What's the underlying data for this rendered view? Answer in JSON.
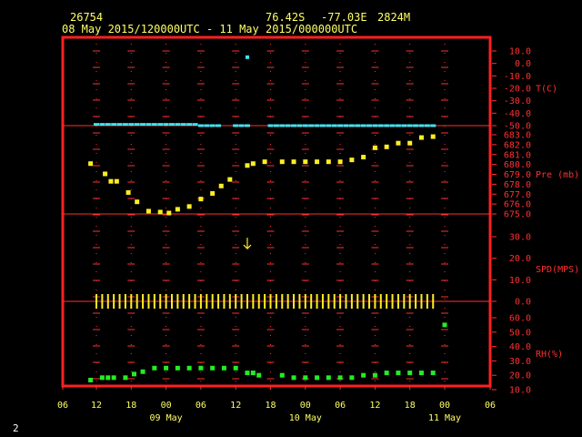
{
  "header": {
    "station_id": "26754",
    "latitude": "76.42S",
    "longitude": "-77.03E",
    "elevation": "2824M",
    "period": "08 May 2015/120000UTC - 11 May 2015/000000UTC"
  },
  "page_number": "2",
  "colors": {
    "frame": "#ff2020",
    "grid": "#ff3030",
    "axis_text_right": "#ff3030",
    "axis_text_bottom": "#ffff66",
    "temperature": "#44e0ee",
    "pressure": "#ffee22",
    "wind": "#ffee22",
    "humidity": "#22ee22"
  },
  "chart_data": {
    "type": "scatter",
    "x_axis": {
      "tick_labels": [
        "06",
        "12",
        "18",
        "00",
        "06",
        "12",
        "18",
        "00",
        "06",
        "12",
        "18",
        "00",
        "06"
      ],
      "tick_hours": [
        -6,
        0,
        6,
        12,
        18,
        24,
        30,
        36,
        42,
        48,
        54,
        60,
        66
      ],
      "date_labels": [
        {
          "label": "09 May",
          "hour": 12
        },
        {
          "label": "10 May",
          "hour": 36
        },
        {
          "label": "11 May",
          "hour": 60
        }
      ],
      "xlim_hours": [
        -6,
        66
      ]
    },
    "panels": [
      {
        "name": "temperature",
        "ylabel": "T(C)",
        "tick_labels": [
          "10.0",
          "0.0",
          "-10.0",
          "-20.0",
          "-30.0",
          "-40.0",
          "-50.0"
        ],
        "ylim": [
          -50,
          10
        ],
        "series": [
          {
            "style": "dash",
            "x": [
              0,
              1,
              2,
              3,
              4,
              5,
              6,
              7,
              8,
              9,
              10,
              11,
              12,
              13,
              14,
              15,
              16,
              17,
              18,
              19,
              20,
              21,
              24,
              25,
              26,
              30,
              31,
              32,
              33,
              34,
              35,
              36,
              37,
              38,
              39,
              40,
              41,
              42,
              43,
              44,
              45,
              46,
              47,
              48,
              49,
              50,
              51,
              52,
              53,
              54,
              55,
              56,
              57,
              58
            ],
            "y": [
              -49,
              -49,
              -49,
              -49,
              -49,
              -49,
              -49,
              -49,
              -49,
              -49,
              -49,
              -49,
              -49,
              -49,
              -49,
              -49,
              -49,
              -49,
              -50,
              -50,
              -50,
              -50,
              -50,
              -50,
              -50,
              -50,
              -50,
              -50,
              -50,
              -50,
              -50,
              -50,
              -50,
              -50,
              -50,
              -50,
              -50,
              -50,
              -50,
              -50,
              -50,
              -50,
              -50,
              -50,
              -50,
              -50,
              -50,
              -50,
              -50,
              -50,
              -50,
              -50,
              -50,
              -50
            ]
          },
          {
            "style": "square",
            "x": [
              26
            ],
            "y": 5
          }
        ]
      },
      {
        "name": "pressure",
        "ylabel": "Pre (mb)",
        "tick_labels": [
          "683.0",
          "682.0",
          "681.0",
          "680.0",
          "679.0",
          "678.0",
          "677.0",
          "676.0",
          "675.0"
        ],
        "ylim": [
          675,
          683.5
        ],
        "series": [
          {
            "style": "square",
            "x": [
              -1,
              1.5,
              2.5,
              3.5,
              5.5,
              7,
              9,
              11,
              12.5,
              14,
              16,
              18,
              20,
              21.5,
              23,
              26,
              27,
              29,
              32,
              34,
              36,
              38,
              40,
              42,
              44,
              46,
              48,
              50,
              52,
              54,
              56,
              58
            ],
            "y": [
              680.4,
              679.3,
              678.5,
              678.5,
              677.3,
              676.3,
              675.3,
              675.2,
              675.1,
              675.5,
              675.8,
              676.6,
              677.2,
              678.0,
              678.7,
              680.2,
              680.4,
              680.6,
              680.6,
              680.6,
              680.6,
              680.6,
              680.6,
              680.6,
              680.8,
              681.1,
              682.1,
              682.2,
              682.6,
              682.6,
              683.2,
              683.3
            ]
          }
        ]
      },
      {
        "name": "wind",
        "ylabel": "SPD(MPS)",
        "tick_labels": [
          "30.0",
          "20.0",
          "10.0",
          "0.0"
        ],
        "ylim": [
          0,
          30
        ],
        "series": [
          {
            "style": "bar",
            "x": [
              0,
              1,
              2,
              3,
              4,
              5,
              6,
              7,
              8,
              9,
              10,
              11,
              12,
              13,
              14,
              15,
              16,
              17,
              18,
              19,
              20,
              21,
              22,
              23,
              24,
              25,
              26,
              27,
              28,
              29,
              30,
              31,
              32,
              33,
              34,
              35,
              36,
              37,
              38,
              39,
              40,
              41,
              42,
              43,
              44,
              45,
              46,
              47,
              48,
              49,
              50,
              51,
              52,
              53,
              54,
              55,
              56,
              57,
              58
            ],
            "y": [
              0,
              0,
              0,
              0,
              0,
              0,
              0,
              0,
              0,
              0,
              0,
              0,
              0,
              0,
              0,
              0,
              0,
              0,
              0,
              0,
              0,
              0,
              0,
              0,
              0,
              0,
              0,
              0,
              0,
              0,
              0,
              0,
              0,
              0,
              0,
              0,
              0,
              0,
              0,
              0,
              0,
              0,
              0,
              0,
              0,
              0,
              0,
              0,
              0,
              0,
              0,
              0,
              0,
              0,
              0,
              0,
              0,
              0,
              0
            ]
          },
          {
            "style": "arrow",
            "x": [
              26
            ],
            "y": 27
          }
        ]
      },
      {
        "name": "humidity",
        "ylabel": "RH(%)",
        "tick_labels": [
          "60.0",
          "50.0",
          "40.0",
          "30.0",
          "20.0",
          "10.0"
        ],
        "ylim": [
          10,
          70
        ],
        "series": [
          {
            "style": "square",
            "x": [
              -1,
              1,
              2,
              3,
              5,
              6.5,
              8,
              10,
              12,
              14,
              16,
              18,
              20,
              22,
              24,
              26,
              27,
              28,
              32,
              34,
              36,
              38,
              40,
              42,
              44,
              46,
              48,
              50,
              52,
              54,
              56,
              58,
              60
            ],
            "y": [
              18,
              20,
              20,
              20,
              20,
              23,
              25,
              28,
              28,
              28,
              28,
              28,
              28,
              28,
              28,
              24,
              24,
              22,
              22,
              20,
              20,
              20,
              20,
              20,
              20,
              22,
              22,
              24,
              24,
              24,
              24,
              24,
              64
            ]
          }
        ]
      }
    ]
  }
}
